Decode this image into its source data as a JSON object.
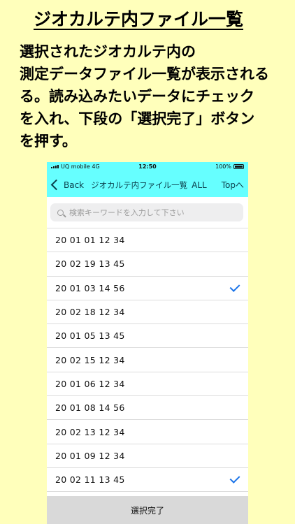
{
  "heading": {
    "title": "ジオカルテ内ファイル一覧",
    "lines": [
      "選択されたジオカルテ内の",
      "測定データファイル一覧が表示される",
      "る。読み込みたいデータにチェック",
      "を入れ、下段の「選択完了」ボタン",
      "を押す。"
    ]
  },
  "status": {
    "carrier": "UQ mobile  4G",
    "time": "12:50",
    "battery": "100%"
  },
  "nav": {
    "back": "Back",
    "title": "ジオカルテ内ファイル一覧",
    "all": "ALL",
    "top": "Topへ"
  },
  "search": {
    "placeholder": "検索キーワードを入力して下さい"
  },
  "files": [
    {
      "name": "20 01 01 12 34",
      "checked": false
    },
    {
      "name": "20 02 19 13 45",
      "checked": false
    },
    {
      "name": "20 01 03 14 56",
      "checked": true
    },
    {
      "name": "20 02 18 12 34",
      "checked": false
    },
    {
      "name": "20 01 05 13 45",
      "checked": false
    },
    {
      "name": "20 02 15 12 34",
      "checked": false
    },
    {
      "name": "20 01 06 12 34",
      "checked": false
    },
    {
      "name": "20 01 08 14 56",
      "checked": false
    },
    {
      "name": "20 02 13 12 34",
      "checked": false
    },
    {
      "name": "20 01 09 12 34",
      "checked": false
    },
    {
      "name": "20 02 11 13 45",
      "checked": true
    }
  ],
  "footer": {
    "button": "選択完了"
  },
  "colors": {
    "accent": "#66ffff",
    "check": "#1a73e8",
    "page": "#ffffbb"
  }
}
